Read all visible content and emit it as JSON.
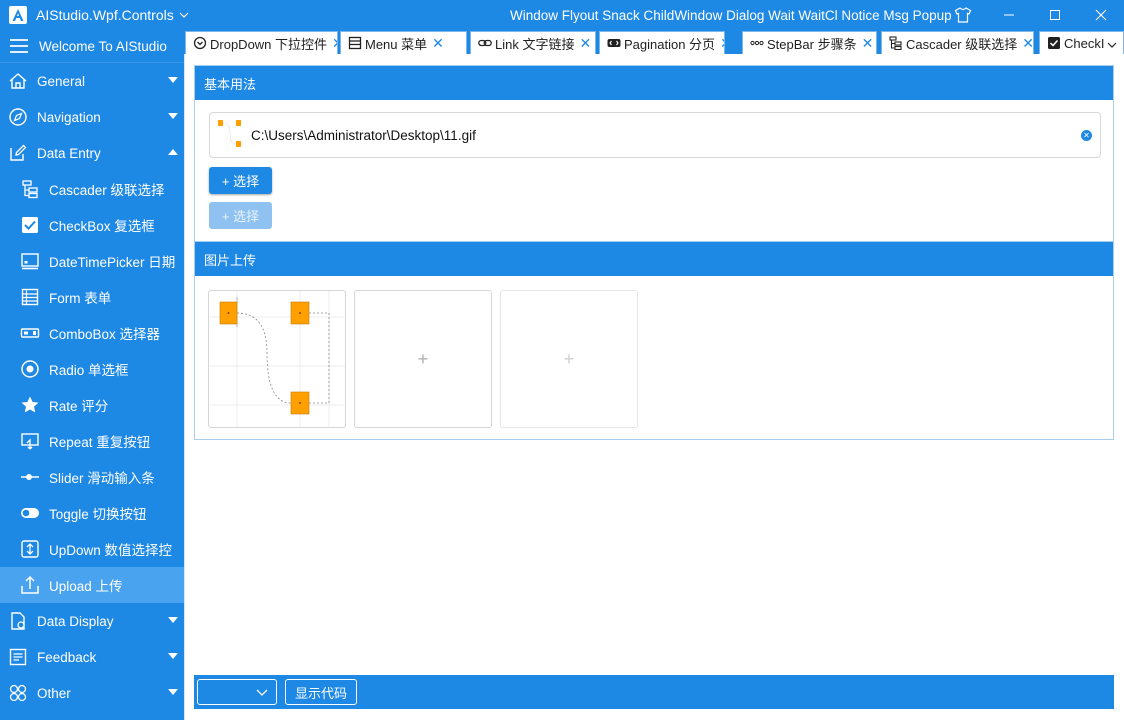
{
  "window": {
    "app_name": "AIStudio.Wpf.Controls",
    "title_links": "Window Flyout Snack ChildWindow Dialog Wait WaitCl Notice Msg Popup",
    "icons": [
      "shirt-icon",
      "minimize-icon",
      "maximize-icon",
      "close-icon"
    ]
  },
  "sidebar": {
    "header": "Welcome To AIStudio",
    "items": [
      {
        "label": "General",
        "icon": "home-icon",
        "level": "top",
        "arrow": "down"
      },
      {
        "label": "Navigation",
        "icon": "compass-icon",
        "level": "top",
        "arrow": "down"
      },
      {
        "label": "Data Entry",
        "icon": "edit-icon",
        "level": "top",
        "arrow": "up"
      },
      {
        "label": "Cascader 级联选择",
        "icon": "cascader-icon",
        "level": "sub"
      },
      {
        "label": "CheckBox 复选框",
        "icon": "checkbox-icon",
        "level": "sub"
      },
      {
        "label": "DateTimePicker 日期",
        "icon": "calendar-icon",
        "level": "sub"
      },
      {
        "label": "Form 表单",
        "icon": "form-icon",
        "level": "sub"
      },
      {
        "label": "ComboBox 选择器",
        "icon": "combobox-icon",
        "level": "sub"
      },
      {
        "label": "Radio 单选框",
        "icon": "radio-icon",
        "level": "sub"
      },
      {
        "label": "Rate 评分",
        "icon": "star-icon",
        "level": "sub"
      },
      {
        "label": "Repeat 重复按钮",
        "icon": "repeat-icon",
        "level": "sub"
      },
      {
        "label": "Slider 滑动输入条",
        "icon": "slider-icon",
        "level": "sub"
      },
      {
        "label": "Toggle 切换按钮",
        "icon": "toggle-icon",
        "level": "sub"
      },
      {
        "label": "UpDown 数值选择控",
        "icon": "updown-icon",
        "level": "sub"
      },
      {
        "label": "Upload 上传",
        "icon": "upload-icon",
        "level": "sub",
        "active": true
      },
      {
        "label": "Data Display",
        "icon": "document-icon",
        "level": "top",
        "arrow": "down"
      },
      {
        "label": "Feedback",
        "icon": "feedback-icon",
        "level": "top",
        "arrow": "down"
      },
      {
        "label": "Other",
        "icon": "other-icon",
        "level": "top",
        "arrow": "down"
      }
    ]
  },
  "tabs": [
    {
      "label": "DropDown 下拉控件",
      "icon": "dropdown-icon",
      "closable": true
    },
    {
      "label": "Menu 菜单",
      "icon": "menu-icon",
      "closable": true
    },
    {
      "label": "Link 文字链接",
      "icon": "link-icon",
      "closable": true
    },
    {
      "label": "Pagination 分页",
      "icon": "pagination-icon",
      "closable": true
    },
    {
      "label": "StepBar 步骤条",
      "icon": "stepbar-icon",
      "closable": true
    },
    {
      "label": "Cascader 级联选择",
      "icon": "cascader-icon",
      "closable": true
    },
    {
      "label": "CheckI",
      "icon": "checkbox-icon",
      "closable": false
    }
  ],
  "basic": {
    "title": "基本用法",
    "file_path": "C:\\Users\\Administrator\\Desktop\\11.gif",
    "select_label": "+ 选择",
    "select_disabled_label": "+ 选择"
  },
  "image_upload": {
    "title": "图片上传",
    "add_placeholder": "+"
  },
  "bottom": {
    "select_value": "",
    "show_code_label": "显示代码"
  },
  "colors": {
    "accent": "#1e88e5",
    "active_item": "#4aa3ef",
    "thumb_orange": "#ffa000"
  }
}
